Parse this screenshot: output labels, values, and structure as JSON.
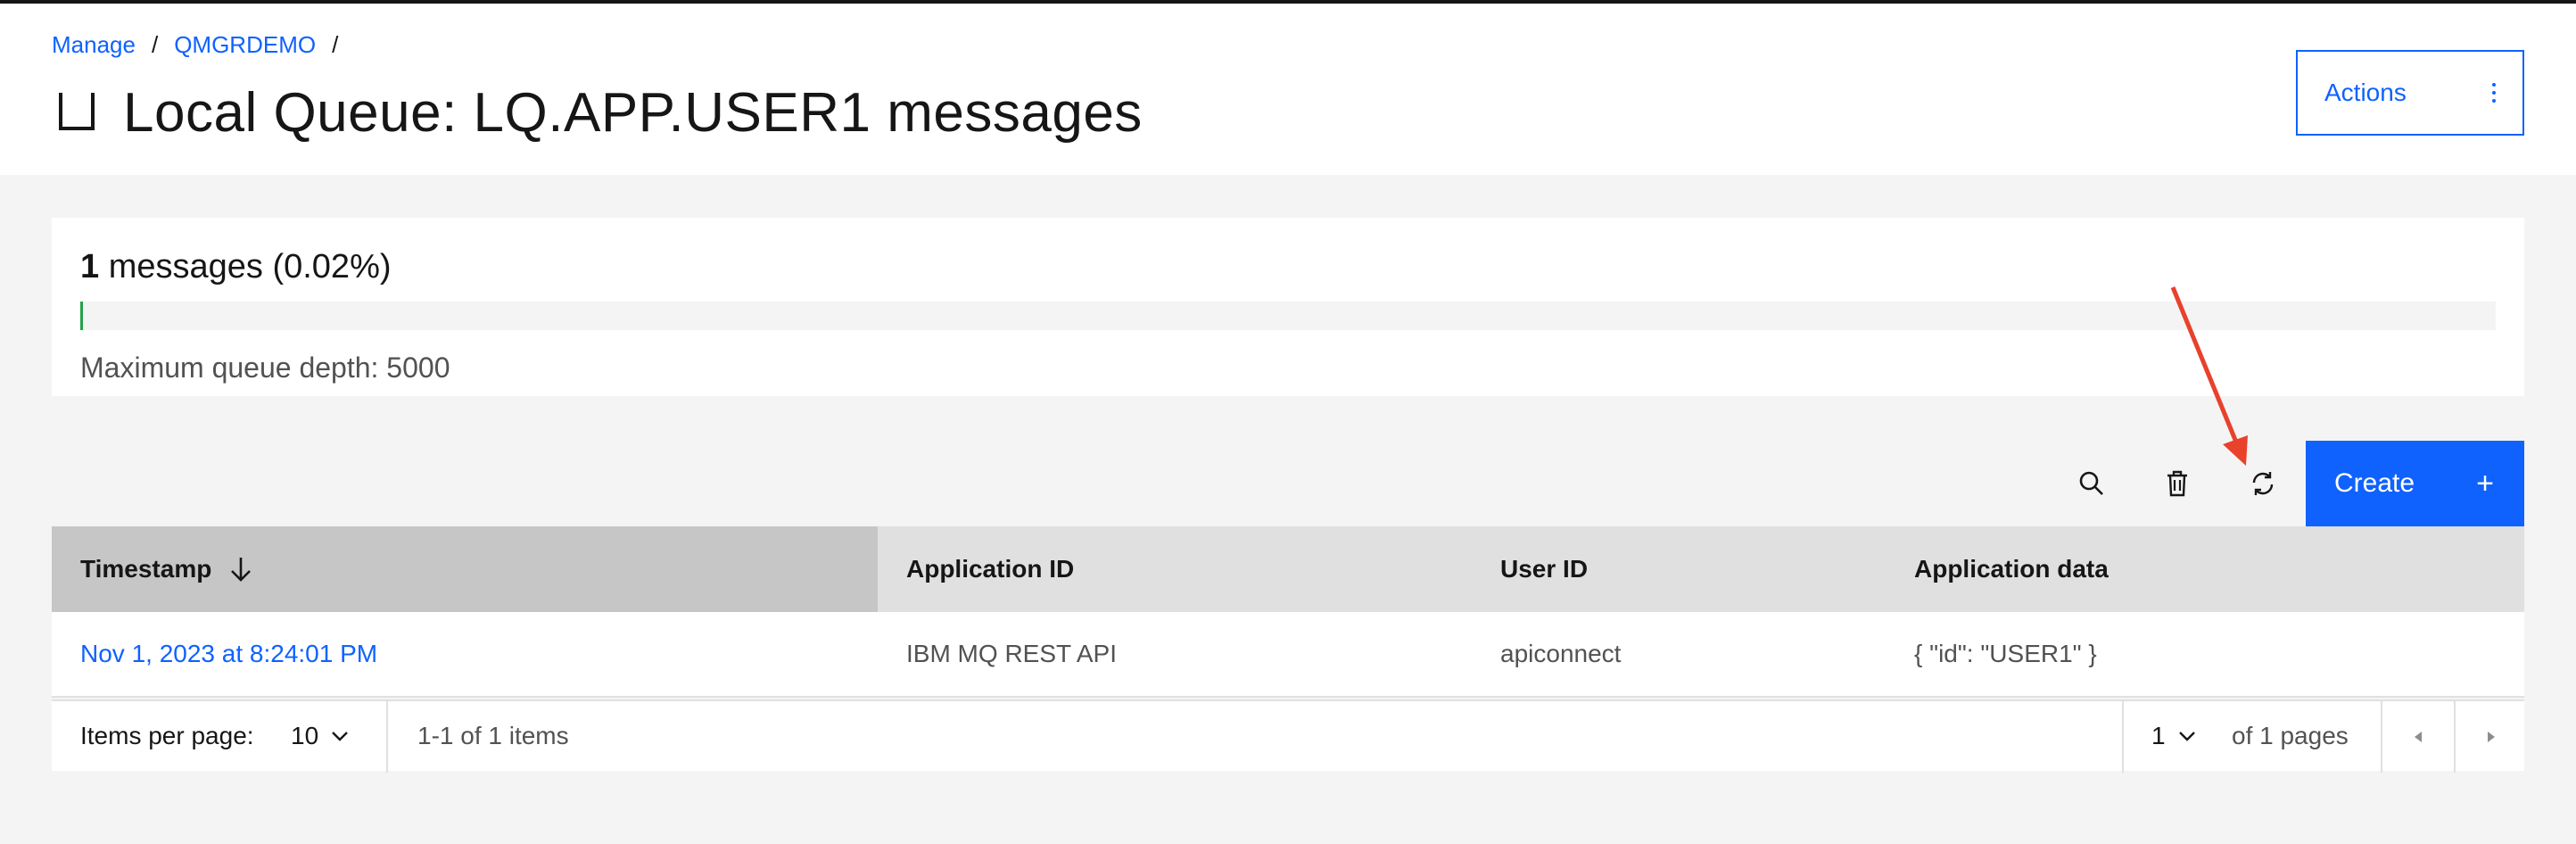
{
  "breadcrumb": {
    "items": [
      "Manage",
      "QMGRDEMO"
    ],
    "separator": "/"
  },
  "header": {
    "title": "Local Queue: LQ.APP.USER1 messages",
    "icon": "queue-icon"
  },
  "actions_button": {
    "label": "Actions",
    "icon": "overflow-menu-icon"
  },
  "depth": {
    "count": "1",
    "count_suffix": "messages (0.02%)",
    "fill_percent": 0.02,
    "max_depth_text": "Maximum queue depth: 5000",
    "fill_color": "#24a148"
  },
  "toolbar": {
    "icons": [
      "search-icon",
      "trash-icon",
      "refresh-icon"
    ],
    "create_label": "Create",
    "create_icon": "plus-icon"
  },
  "table": {
    "headers": [
      "Timestamp",
      "Application ID",
      "User ID",
      "Application data"
    ],
    "sort_icon": "arrow-down-icon",
    "rows": [
      [
        "Nov 1, 2023 at 8:24:01 PM",
        "IBM MQ REST API",
        "apiconnect",
        "{ \"id\": \"USER1\" }"
      ]
    ]
  },
  "pagination": {
    "items_per_page_label": "Items per page:",
    "items_per_page": "10",
    "range_text": "1-1 of 1 items",
    "current_page": "1",
    "pages_text": "of 1 pages"
  },
  "colors": {
    "accent": "#0f62fe",
    "annotation": "#e8412c"
  }
}
